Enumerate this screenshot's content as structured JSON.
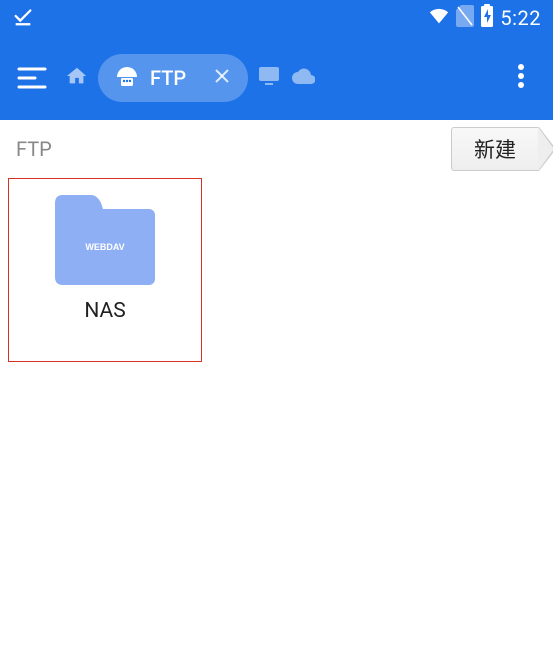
{
  "status": {
    "time": "5:22"
  },
  "header": {
    "active_tab_label": "FTP"
  },
  "breadcrumb": {
    "path": "FTP",
    "new_button_label": "新建"
  },
  "content": {
    "items": [
      {
        "name": "NAS",
        "badge": "WEBDAV"
      }
    ]
  }
}
